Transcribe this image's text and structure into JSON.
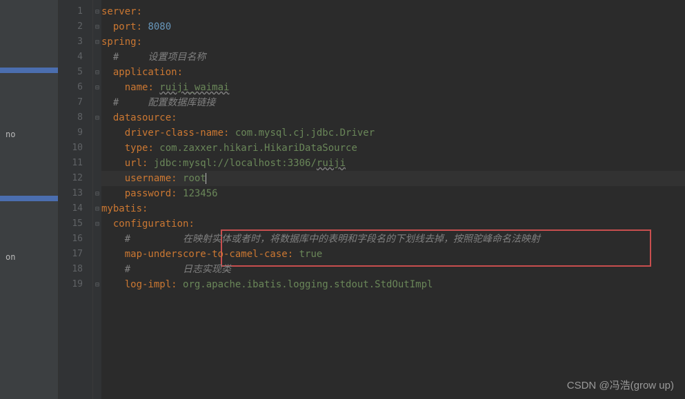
{
  "sidebar": {
    "item_no": "no",
    "item_on": "on"
  },
  "lines": [
    {
      "num": "1",
      "fold": "⊟",
      "segs": [
        {
          "t": "field",
          "v": "server"
        },
        {
          "t": "punc",
          "v": ":"
        }
      ]
    },
    {
      "num": "2",
      "fold": "⊟",
      "segs": [
        {
          "t": "plain",
          "v": "  "
        },
        {
          "t": "field",
          "v": "port"
        },
        {
          "t": "punc",
          "v": ": "
        },
        {
          "t": "num",
          "v": "8080"
        }
      ]
    },
    {
      "num": "3",
      "fold": "⊟",
      "segs": [
        {
          "t": "field",
          "v": "spring"
        },
        {
          "t": "punc",
          "v": ":"
        }
      ]
    },
    {
      "num": "4",
      "fold": "",
      "segs": [
        {
          "t": "plain",
          "v": "  "
        },
        {
          "t": "comment",
          "v": "#     设置项目名称"
        }
      ]
    },
    {
      "num": "5",
      "fold": "⊟",
      "segs": [
        {
          "t": "plain",
          "v": "  "
        },
        {
          "t": "field",
          "v": "application"
        },
        {
          "t": "punc",
          "v": ":"
        }
      ]
    },
    {
      "num": "6",
      "fold": "⊟",
      "segs": [
        {
          "t": "plain",
          "v": "    "
        },
        {
          "t": "field",
          "v": "name"
        },
        {
          "t": "punc",
          "v": ": "
        },
        {
          "t": "value-wavy",
          "v": "ruiji_waimai"
        }
      ]
    },
    {
      "num": "7",
      "fold": "",
      "segs": [
        {
          "t": "plain",
          "v": "  "
        },
        {
          "t": "comment",
          "v": "#     配置数据库链接"
        }
      ]
    },
    {
      "num": "8",
      "fold": "⊟",
      "segs": [
        {
          "t": "plain",
          "v": "  "
        },
        {
          "t": "field",
          "v": "datasource"
        },
        {
          "t": "punc",
          "v": ":"
        }
      ]
    },
    {
      "num": "9",
      "fold": "",
      "segs": [
        {
          "t": "plain",
          "v": "    "
        },
        {
          "t": "field",
          "v": "driver-class-name"
        },
        {
          "t": "punc",
          "v": ": "
        },
        {
          "t": "value",
          "v": "com.mysql.cj.jdbc.Driver"
        }
      ]
    },
    {
      "num": "10",
      "fold": "",
      "segs": [
        {
          "t": "plain",
          "v": "    "
        },
        {
          "t": "field",
          "v": "type"
        },
        {
          "t": "punc",
          "v": ": "
        },
        {
          "t": "value",
          "v": "com.zaxxer.hikari.HikariDataSource"
        }
      ]
    },
    {
      "num": "11",
      "fold": "",
      "segs": [
        {
          "t": "plain",
          "v": "    "
        },
        {
          "t": "field",
          "v": "url"
        },
        {
          "t": "punc",
          "v": ": "
        },
        {
          "t": "value",
          "v": "jdbc:mysql://localhost:3306/"
        },
        {
          "t": "value-wavy",
          "v": "ruiji"
        }
      ]
    },
    {
      "num": "12",
      "fold": "",
      "current": true,
      "segs": [
        {
          "t": "plain",
          "v": "    "
        },
        {
          "t": "field",
          "v": "username"
        },
        {
          "t": "punc",
          "v": ": "
        },
        {
          "t": "value",
          "v": "root"
        },
        {
          "t": "caret",
          "v": ""
        }
      ]
    },
    {
      "num": "13",
      "fold": "⊟",
      "segs": [
        {
          "t": "plain",
          "v": "    "
        },
        {
          "t": "field",
          "v": "password"
        },
        {
          "t": "punc",
          "v": ": "
        },
        {
          "t": "value",
          "v": "123456"
        }
      ]
    },
    {
      "num": "14",
      "fold": "⊟",
      "segs": [
        {
          "t": "field",
          "v": "mybatis"
        },
        {
          "t": "punc",
          "v": ":"
        }
      ]
    },
    {
      "num": "15",
      "fold": "⊟",
      "segs": [
        {
          "t": "plain",
          "v": "  "
        },
        {
          "t": "field",
          "v": "configuration"
        },
        {
          "t": "punc",
          "v": ":"
        }
      ]
    },
    {
      "num": "16",
      "fold": "",
      "segs": [
        {
          "t": "plain",
          "v": "    "
        },
        {
          "t": "comment",
          "v": "#         在映射实体或者时，将数据库中的表明和字段名的下划线去掉，按照驼峰命名法映射"
        }
      ]
    },
    {
      "num": "17",
      "fold": "",
      "segs": [
        {
          "t": "plain",
          "v": "    "
        },
        {
          "t": "field",
          "v": "map-underscore-to-camel-case"
        },
        {
          "t": "punc",
          "v": ": "
        },
        {
          "t": "value",
          "v": "true"
        }
      ]
    },
    {
      "num": "18",
      "fold": "",
      "segs": [
        {
          "t": "plain",
          "v": "    "
        },
        {
          "t": "comment",
          "v": "#         日志实现类"
        }
      ]
    },
    {
      "num": "19",
      "fold": "⊟",
      "segs": [
        {
          "t": "plain",
          "v": "    "
        },
        {
          "t": "field",
          "v": "log-impl"
        },
        {
          "t": "punc",
          "v": ": "
        },
        {
          "t": "value",
          "v": "org.apache.ibatis.logging.stdout.StdOutImpl"
        }
      ]
    }
  ],
  "watermark": "CSDN @冯浩(grow up)"
}
